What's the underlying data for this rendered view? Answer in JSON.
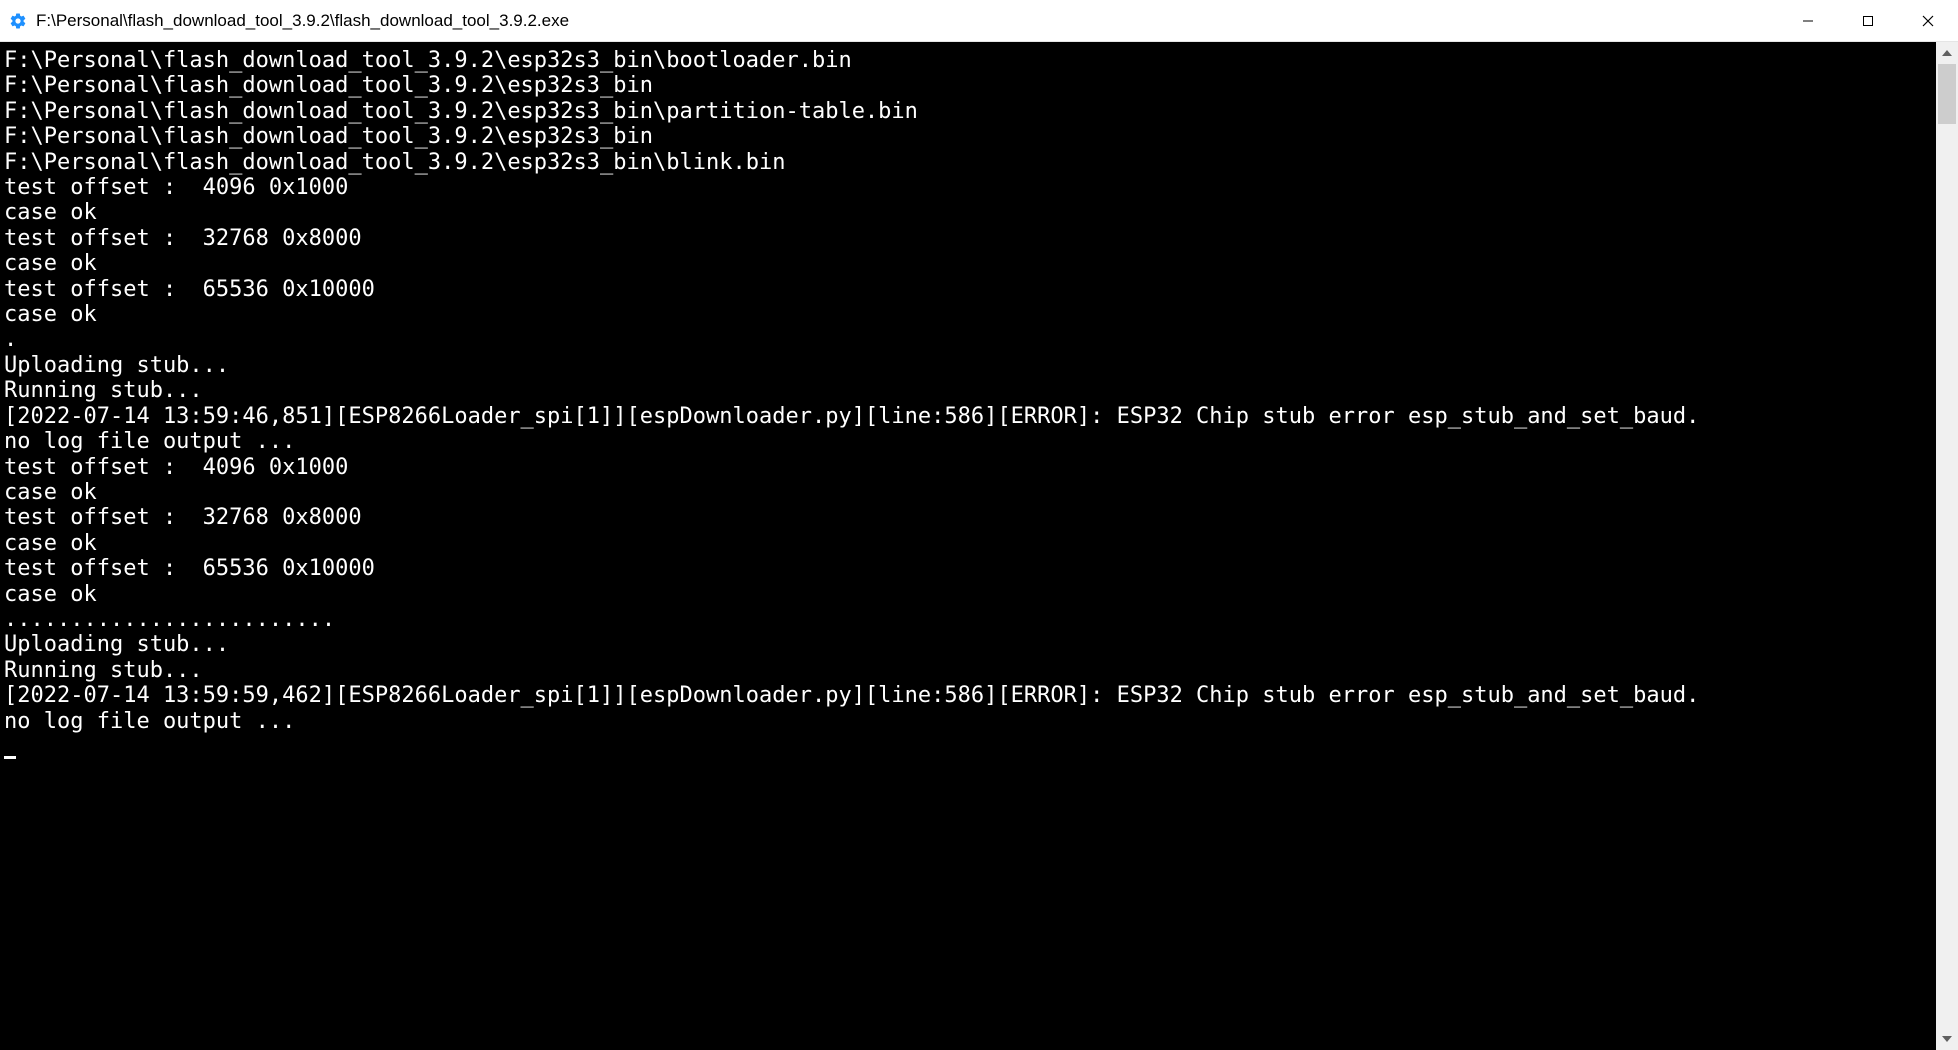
{
  "window": {
    "title": "F:\\Personal\\flash_download_tool_3.9.2\\flash_download_tool_3.9.2.exe"
  },
  "console": {
    "lines": [
      "F:\\Personal\\flash_download_tool_3.9.2\\esp32s3_bin\\bootloader.bin",
      "F:\\Personal\\flash_download_tool_3.9.2\\esp32s3_bin",
      "F:\\Personal\\flash_download_tool_3.9.2\\esp32s3_bin\\partition-table.bin",
      "F:\\Personal\\flash_download_tool_3.9.2\\esp32s3_bin",
      "F:\\Personal\\flash_download_tool_3.9.2\\esp32s3_bin\\blink.bin",
      "test offset :  4096 0x1000",
      "case ok",
      "test offset :  32768 0x8000",
      "case ok",
      "test offset :  65536 0x10000",
      "case ok",
      ".",
      "Uploading stub...",
      "Running stub...",
      "[2022-07-14 13:59:46,851][ESP8266Loader_spi[1]][espDownloader.py][line:586][ERROR]: ESP32 Chip stub error esp_stub_and_set_baud.",
      "no log file output ...",
      "test offset :  4096 0x1000",
      "case ok",
      "test offset :  32768 0x8000",
      "case ok",
      "test offset :  65536 0x10000",
      "case ok",
      ".........................",
      "Uploading stub...",
      "Running stub...",
      "[2022-07-14 13:59:59,462][ESP8266Loader_spi[1]][espDownloader.py][line:586][ERROR]: ESP32 Chip stub error esp_stub_and_set_baud.",
      "no log file output ..."
    ]
  }
}
